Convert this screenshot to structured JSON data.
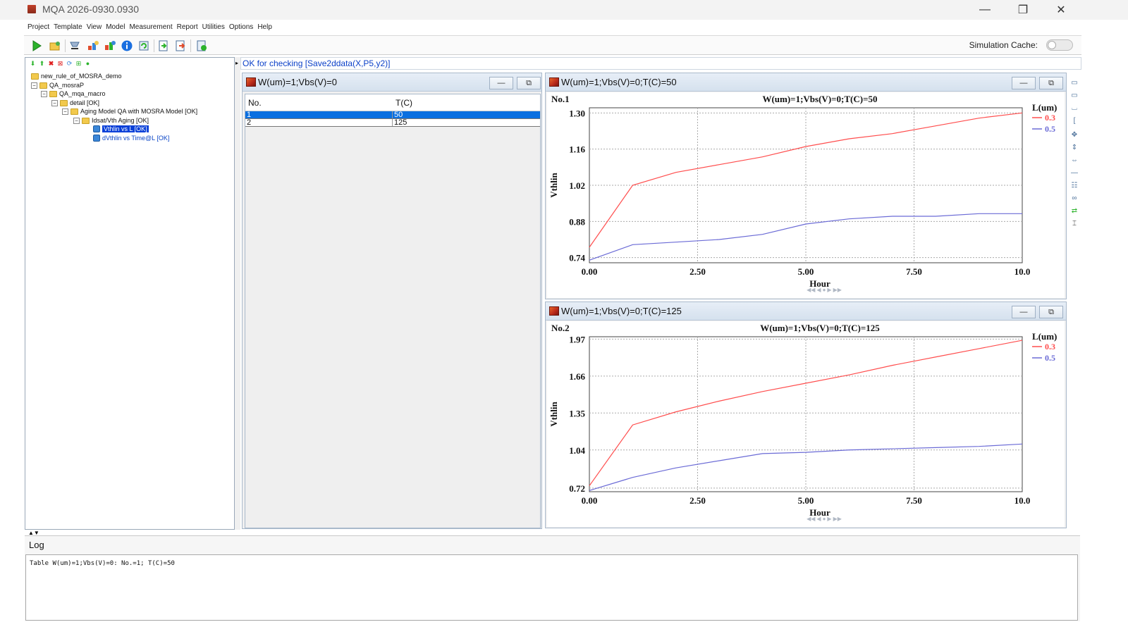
{
  "window": {
    "title": "MQA 2026-0930.0930",
    "minimize": "—",
    "maximize": "❐",
    "close": "✕"
  },
  "menu": [
    "Project",
    "Template",
    "View",
    "Model",
    "Measurement",
    "Report",
    "Utilities",
    "Options",
    "Help"
  ],
  "toolbar": {
    "simulation_cache_label": "Simulation Cache:"
  },
  "tree": {
    "items": [
      {
        "label": "new_rule_of_MOSRA_demo"
      },
      {
        "label": "QA_mosraP"
      },
      {
        "label": "QA_mqa_macro"
      },
      {
        "label": "detail [OK]"
      },
      {
        "label": "Aging Model QA with MOSRA Model [OK]"
      },
      {
        "label": "Idsat/Vth Aging [OK]"
      },
      {
        "label": "Vthlin vs L [OK]"
      },
      {
        "label": "dVthlin vs Time@L [OK]"
      }
    ]
  },
  "status": {
    "message": "OK for checking [Save2ddata(X,P5,y2)]"
  },
  "table_window": {
    "title": "W(um)=1;Vbs(V)=0",
    "columns": [
      "No.",
      "T(C)"
    ],
    "rows": [
      [
        "1",
        "50"
      ],
      [
        "2",
        "125"
      ]
    ]
  },
  "chart_windows": [
    {
      "title": "W(um)=1;Vbs(V)=0;T(C)=50"
    },
    {
      "title": "W(um)=1;Vbs(V)=0;T(C)=125"
    }
  ],
  "chart_data": [
    {
      "type": "line",
      "panel_label": "No.1",
      "title": "W(um)=1;Vbs(V)=0;T(C)=50",
      "xlabel": "Hour",
      "ylabel": "Vthlin",
      "xlim": [
        0,
        10
      ],
      "ylim": [
        0.72,
        1.32
      ],
      "xticks": [
        "0.00",
        "2.50",
        "5.00",
        "7.50",
        "10.0"
      ],
      "xtick_values": [
        0,
        2.5,
        5,
        7.5,
        10
      ],
      "yticks": [
        "0.74",
        "0.88",
        "1.02",
        "1.16",
        "1.30"
      ],
      "ytick_values": [
        0.74,
        0.88,
        1.02,
        1.16,
        1.3
      ],
      "legend_title": "L(um)",
      "legend_position": "top-right",
      "grid": true,
      "x": [
        0,
        1,
        2,
        3,
        4,
        5,
        6,
        7,
        8,
        9,
        10
      ],
      "series": [
        {
          "name": "0.3",
          "color": "#ff4d4d",
          "values": [
            0.78,
            1.02,
            1.07,
            1.1,
            1.13,
            1.17,
            1.2,
            1.22,
            1.25,
            1.28,
            1.3
          ]
        },
        {
          "name": "0.5",
          "color": "#6b6bd6",
          "values": [
            0.73,
            0.79,
            0.8,
            0.81,
            0.83,
            0.87,
            0.89,
            0.9,
            0.9,
            0.91,
            0.91
          ]
        }
      ]
    },
    {
      "type": "line",
      "panel_label": "No.2",
      "title": "W(um)=1;Vbs(V)=0;T(C)=125",
      "xlabel": "Hour",
      "ylabel": "Vthlin",
      "xlim": [
        0,
        10
      ],
      "ylim": [
        0.69,
        1.99
      ],
      "xticks": [
        "0.00",
        "2.50",
        "5.00",
        "7.50",
        "10.0"
      ],
      "xtick_values": [
        0,
        2.5,
        5,
        7.5,
        10
      ],
      "yticks": [
        "0.72",
        "1.04",
        "1.35",
        "1.66",
        "1.97"
      ],
      "ytick_values": [
        0.72,
        1.04,
        1.35,
        1.66,
        1.97
      ],
      "legend_title": "L(um)",
      "legend_position": "top-right",
      "grid": true,
      "x": [
        0,
        1,
        2,
        3,
        4,
        5,
        6,
        7,
        8,
        9,
        10
      ],
      "series": [
        {
          "name": "0.3",
          "color": "#ff4d4d",
          "values": [
            0.74,
            1.25,
            1.36,
            1.45,
            1.53,
            1.6,
            1.67,
            1.75,
            1.82,
            1.89,
            1.96
          ]
        },
        {
          "name": "0.5",
          "color": "#6b6bd6",
          "values": [
            0.7,
            0.81,
            0.89,
            0.95,
            1.01,
            1.02,
            1.04,
            1.05,
            1.06,
            1.07,
            1.09
          ]
        }
      ]
    }
  ],
  "log": {
    "title": "Log",
    "text": "Table W(um)=1;Vbs(V)=0: No.=1; T(C)=50"
  }
}
